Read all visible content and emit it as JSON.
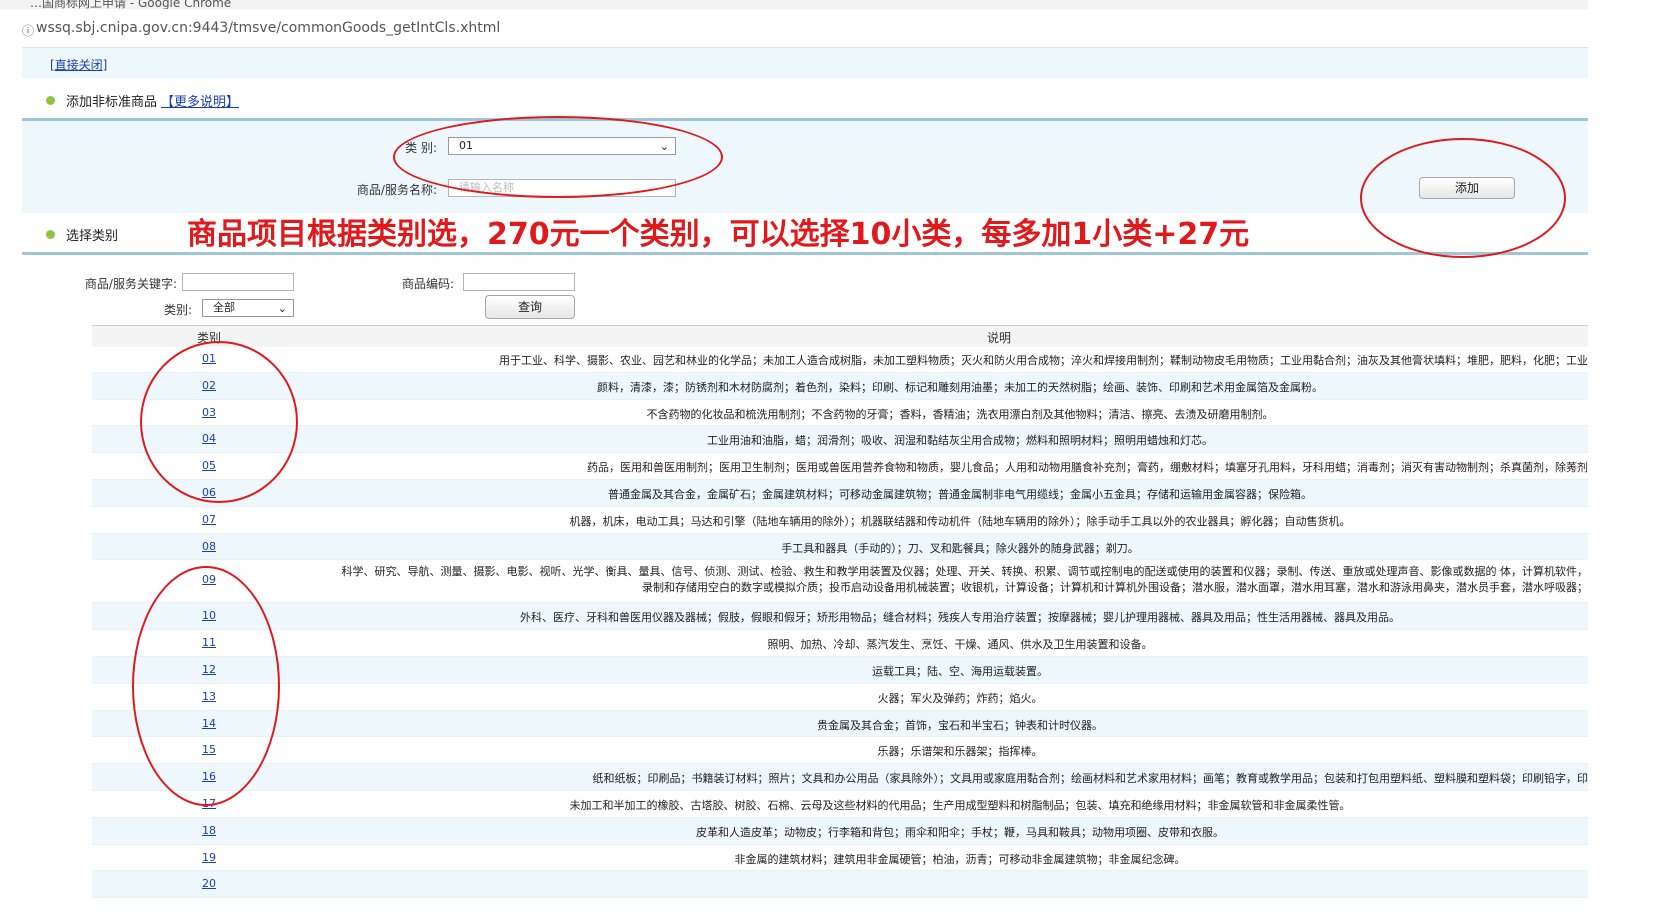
{
  "browser": {
    "window_title": "…国商标网上申请 - Google Chrome",
    "url": "wssq.sbj.cnipa.gov.cn:9443/tmsve/commonGoods_getIntCls.xhtml"
  },
  "top_link": "[直接关闭]",
  "section1": {
    "title": "添加非标准商品",
    "more": "【更多说明】"
  },
  "form1": {
    "class_label": "类 别:",
    "class_value": "01",
    "name_label": "商品/服务名称:",
    "name_placeholder": "请输入名称",
    "add_button": "添加"
  },
  "section2": {
    "title": "选择类别"
  },
  "annotation": "商品项目根据类别选，270元一个类别，可以选择10小类，每多加1小类+27元",
  "search": {
    "keyword_label": "商品/服务关键字:",
    "code_label": "商品编码:",
    "class_label": "类别:",
    "class_value": "全部",
    "query_button": "查询"
  },
  "table": {
    "headers": [
      "类别",
      "说明"
    ],
    "rows": [
      {
        "num": "01",
        "desc": "用于工业、科学、摄影、农业、园艺和林业的化学品；未加工人造合成树脂，未加工塑料物质；灭火和防火用合成物；淬火和焊接用制剂；鞣制动物皮毛用物质；工业用黏合剂；油灰及其他膏状填料；堆肥，肥料，化肥；工业"
      },
      {
        "num": "02",
        "desc": "颜料，清漆，漆；防锈剂和木材防腐剂；着色剂，染料；印刷、标记和雕刻用油墨；未加工的天然树脂；绘画、装饰、印刷和艺术用金属箔及金属粉。"
      },
      {
        "num": "03",
        "desc": "不含药物的化妆品和梳洗用制剂；不含药物的牙膏；香料，香精油；洗衣用漂白剂及其他物料；清洁、擦亮、去渍及研磨用制剂。"
      },
      {
        "num": "04",
        "desc": "工业用油和油脂，蜡；润滑剂；吸收、润湿和黏结灰尘用合成物；燃料和照明材料；照明用蜡烛和灯芯。"
      },
      {
        "num": "05",
        "desc": "药品，医用和兽医用制剂；医用卫生制剂；医用或兽医用营养食物和物质，婴儿食品；人用和动物用膳食补充剂；膏药，绷敷材料；填塞牙孔用料，牙科用蜡；消毒剂；消灭有害动物制剂；杀真菌剂，除莠剂"
      },
      {
        "num": "06",
        "desc": "普通金属及其合金，金属矿石；金属建筑材料；可移动金属建筑物；普通金属制非电气用缆线；金属小五金具；存储和运输用金属容器；保险箱。"
      },
      {
        "num": "07",
        "desc": "机器，机床，电动工具；马达和引擎（陆地车辆用的除外）；机器联结器和传动机件（陆地车辆用的除外）；除手动手工具以外的农业器具；孵化器；自动售货机。"
      },
      {
        "num": "08",
        "desc": "手工具和器具（手动的）；刀、叉和匙餐具；除火器外的随身武器；剃刀。"
      },
      {
        "num": "09",
        "desc": "科学、研究、导航、测量、摄影、电影、视听、光学、衡具、量具、信号、侦测、测试、检验、救生和教学用装置及仪器；处理、开关、转换、积累、调节或控制电的配送或使用的装置和仪器；录制、传送、重放或处理声音、影像或数据的 体，计算机软件，录制和存储用空白的数字或模拟介质；投币启动设备用机械装置；收银机，计算设备；计算机和计算机外围设备；潜水服，潜水面罩，潜水用耳塞，潜水和游泳用鼻夹，潜水员手套，潜水呼吸器；"
      },
      {
        "num": "10",
        "desc": "外科、医疗、牙科和兽医用仪器及器械；假肢，假眼和假牙；矫形用物品；缝合材料；残疾人专用治疗装置；按摩器械；婴儿护理用器械、器具及用品；性生活用器械、器具及用品。"
      },
      {
        "num": "11",
        "desc": "照明、加热、冷却、蒸汽发生、烹饪、干燥、通风、供水及卫生用装置和设备。"
      },
      {
        "num": "12",
        "desc": "运载工具；陆、空、海用运载装置。"
      },
      {
        "num": "13",
        "desc": "火器；军火及弹药；炸药；焰火。"
      },
      {
        "num": "14",
        "desc": "贵金属及其合金；首饰，宝石和半宝石；钟表和计时仪器。"
      },
      {
        "num": "15",
        "desc": "乐器；乐谱架和乐器架；指挥棒。"
      },
      {
        "num": "16",
        "desc": "纸和纸板；印刷品；书籍装订材料；照片；文具和办公用品（家具除外）；文具用或家庭用黏合剂；绘画材料和艺术家用材料；画笔；教育或教学用品；包装和打包用塑料纸、塑料膜和塑料袋；印刷铅字，印"
      },
      {
        "num": "17",
        "desc": "未加工和半加工的橡胶、古塔胶、树胶、石棉、云母及这些材料的代用品；生产用成型塑料和树脂制品；包装、填充和绝缘用材料；非金属软管和非金属柔性管。"
      },
      {
        "num": "18",
        "desc": "皮革和人造皮革；动物皮；行李箱和背包；雨伞和阳伞；手杖；鞭，马具和鞍具；动物用项圈、皮带和衣服。"
      },
      {
        "num": "19",
        "desc": "非金属的建筑材料；建筑用非金属硬管；柏油，沥青；可移动非金属建筑物；非金属纪念碑。"
      },
      {
        "num": "20",
        "desc": ""
      }
    ]
  },
  "colors": {
    "annotation_red": "#e0191c",
    "link_blue": "#1a3fb0",
    "band": "#eef7fb",
    "bullet_green": "#8cc63f"
  }
}
